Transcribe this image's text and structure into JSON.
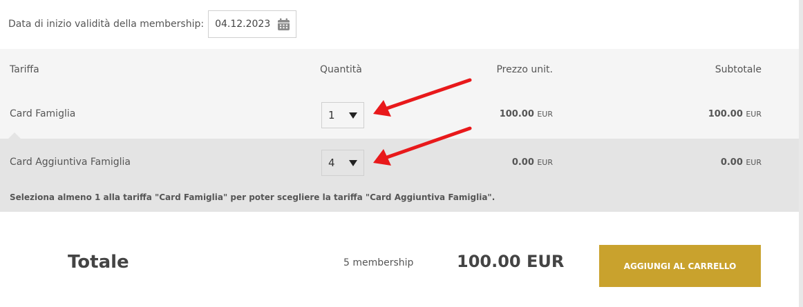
{
  "membership": {
    "start_label": "Data di inizio validità della membership:",
    "start_value": "04.12.2023",
    "calendar_icon": "calendar-icon"
  },
  "table": {
    "headers": {
      "tariff": "Tariffa",
      "quantity": "Quantità",
      "unit_price": "Prezzo unit.",
      "subtotal": "Subtotale"
    },
    "rows": [
      {
        "tariff": "Card Famiglia",
        "quantity": "1",
        "unit_price": "100.00",
        "unit_currency": "EUR",
        "subtotal": "100.00",
        "subtotal_currency": "EUR"
      },
      {
        "tariff": "Card Aggiuntiva Famiglia",
        "quantity": "4",
        "unit_price": "0.00",
        "unit_currency": "EUR",
        "subtotal": "0.00",
        "subtotal_currency": "EUR"
      }
    ],
    "notice": "Seleziona almeno 1 alla tariffa \"Card Famiglia\" per poter scegliere la tariffa \"Card Aggiuntiva Famiglia\"."
  },
  "summary": {
    "total_label": "Totale",
    "membership_count": "5 membership",
    "total_amount": "100.00 EUR",
    "add_to_cart_label": "AGGIUNGI AL CARRELLO"
  },
  "colors": {
    "accent": "#c9a22d",
    "annotation_arrow": "#e8191b",
    "header_bg": "#f5f5f5",
    "highlight_row_bg": "#e4e4e4"
  }
}
